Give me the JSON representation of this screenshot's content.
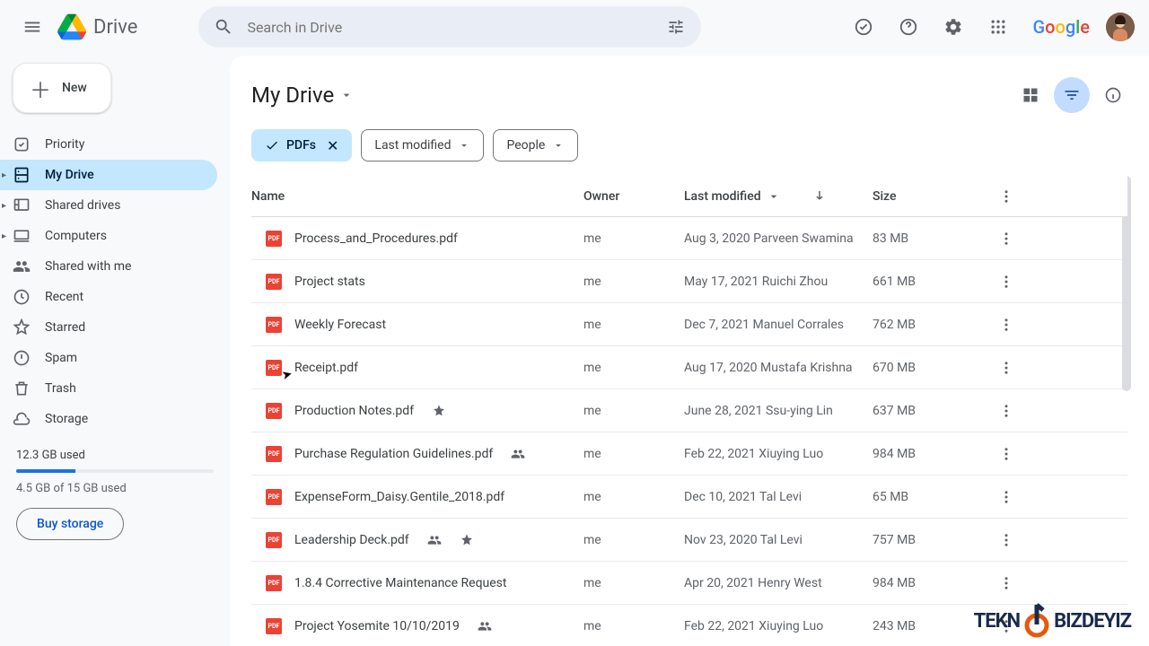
{
  "app": {
    "name": "Drive"
  },
  "search": {
    "placeholder": "Search in Drive"
  },
  "new_btn": "New",
  "sidebar": {
    "items": [
      {
        "label": "Priority"
      },
      {
        "label": "My Drive"
      },
      {
        "label": "Shared drives"
      },
      {
        "label": "Computers"
      },
      {
        "label": "Shared with me"
      },
      {
        "label": "Recent"
      },
      {
        "label": "Starred"
      },
      {
        "label": "Spam"
      },
      {
        "label": "Trash"
      },
      {
        "label": "Storage"
      }
    ]
  },
  "storage": {
    "headline": "12.3 GB used",
    "detail": "4.5 GB of 15 GB used",
    "buy_label": "Buy storage"
  },
  "main": {
    "title": "My Drive"
  },
  "chips": {
    "pdfs": "PDFs",
    "last_modified": "Last modified",
    "people": "People"
  },
  "columns": {
    "name": "Name",
    "owner": "Owner",
    "last_modified": "Last modified",
    "size": "Size"
  },
  "files": [
    {
      "name": "Process_and_Procedures.pdf",
      "owner": "me",
      "modified": "Aug 3, 2020 Parveen Swamina",
      "size": "83 MB",
      "starred": false,
      "shared": false
    },
    {
      "name": "Project stats",
      "owner": "me",
      "modified": "May 17, 2021 Ruichi Zhou",
      "size": "661 MB",
      "starred": false,
      "shared": false
    },
    {
      "name": "Weekly Forecast",
      "owner": "me",
      "modified": "Dec 7, 2021 Manuel Corrales",
      "size": "762 MB",
      "starred": false,
      "shared": false
    },
    {
      "name": "Receipt.pdf",
      "owner": "me",
      "modified": "Aug 17, 2020 Mustafa Krishna",
      "size": "670 MB",
      "starred": false,
      "shared": false
    },
    {
      "name": "Production Notes.pdf",
      "owner": "me",
      "modified": "June 28, 2021 Ssu-ying Lin",
      "size": "637 MB",
      "starred": true,
      "shared": false
    },
    {
      "name": "Purchase Regulation Guidelines.pdf",
      "owner": "me",
      "modified": "Feb 22, 2021 Xiuying Luo",
      "size": "984 MB",
      "starred": false,
      "shared": true
    },
    {
      "name": "ExpenseForm_Daisy.Gentile_2018.pdf",
      "owner": "me",
      "modified": "Dec 10, 2021 Tal Levi",
      "size": "65 MB",
      "starred": false,
      "shared": false
    },
    {
      "name": "Leadership Deck.pdf",
      "owner": "me",
      "modified": "Nov 23, 2020 Tal Levi",
      "size": "757 MB",
      "starred": true,
      "shared": true
    },
    {
      "name": "1.8.4 Corrective Maintenance Request",
      "owner": "me",
      "modified": "Apr 20, 2021 Henry West",
      "size": "984 MB",
      "starred": false,
      "shared": false
    },
    {
      "name": "Project Yosemite 10/10/2019",
      "owner": "me",
      "modified": "Feb 22, 2021 Xiuying Luo",
      "size": "243 MB",
      "starred": false,
      "shared": true
    }
  ],
  "watermark": {
    "text1": "TEKN",
    "text2": "BIZDEYIZ"
  }
}
